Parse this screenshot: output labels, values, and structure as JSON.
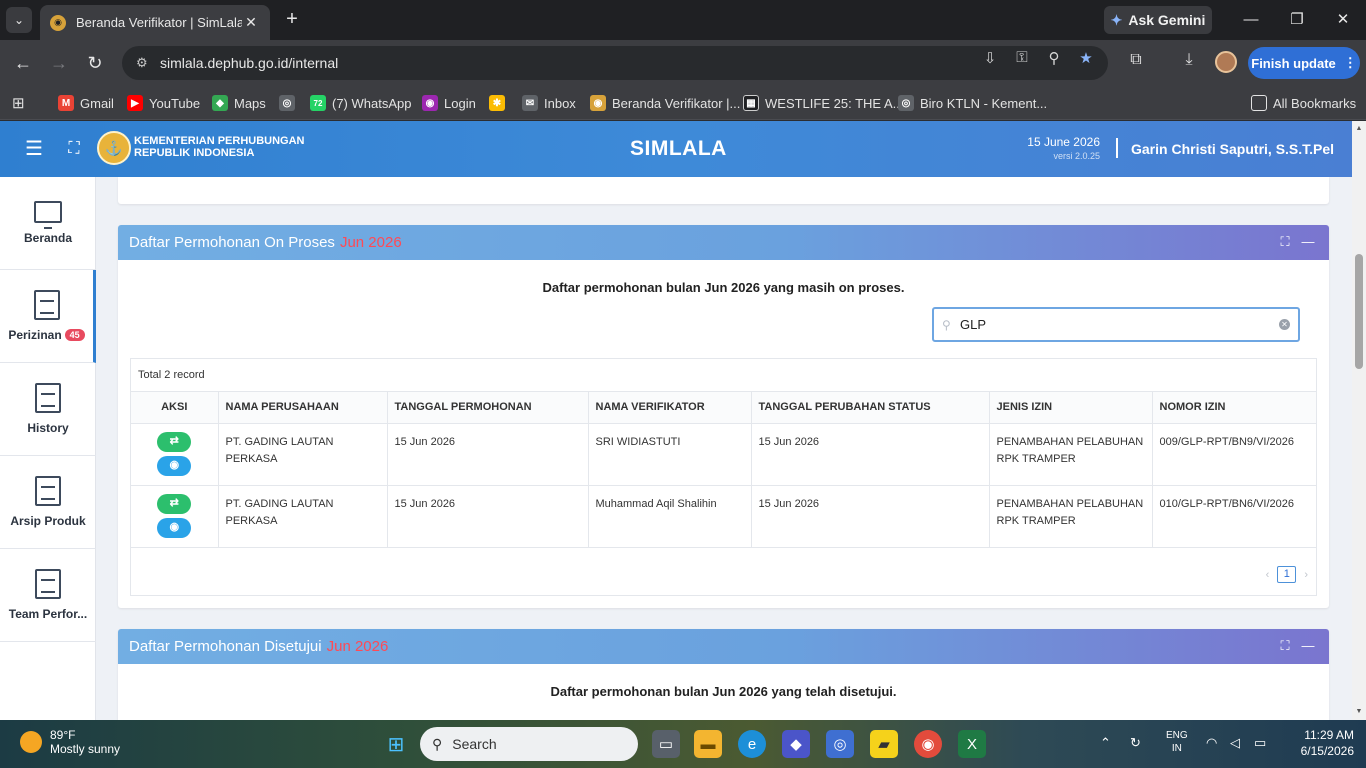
{
  "browser": {
    "tab_title": "Beranda Verifikator | SimLala",
    "tab_close": "✕",
    "new_tab": "+",
    "ask_gemini": "Ask Gemini",
    "url": "simlala.dephub.go.id/internal",
    "finish_update": "Finish update",
    "bookmarks": [
      {
        "label": "Gmail",
        "icon": "gmail-icon",
        "color": "#ea4335",
        "glyph": "M"
      },
      {
        "label": "YouTube",
        "icon": "youtube-icon",
        "color": "#ff0000",
        "glyph": "▶"
      },
      {
        "label": "Maps",
        "icon": "maps-icon",
        "color": "#34a853",
        "glyph": "◆"
      },
      {
        "label": "",
        "icon": "globe-icon",
        "color": "#5f6368",
        "glyph": "◎"
      },
      {
        "label": "(7) WhatsApp",
        "icon": "whatsapp-icon",
        "color": "#25d366",
        "glyph": "72"
      },
      {
        "label": "Login",
        "icon": "login-icon",
        "color": "#9c27b0",
        "glyph": "◉"
      },
      {
        "label": "",
        "icon": "pinwheel-icon",
        "color": "#fbbc04",
        "glyph": "✱"
      },
      {
        "label": "Inbox",
        "icon": "inbox-icon",
        "color": "#5f6368",
        "glyph": "✉"
      },
      {
        "label": "Beranda Verifikator |...",
        "icon": "simlala-icon",
        "color": "#d7a23a",
        "glyph": "◉"
      },
      {
        "label": "WESTLIFE 25: THE A...",
        "icon": "westlife-icon",
        "color": "#202124",
        "glyph": "▦"
      },
      {
        "label": "Biro KTLN - Kement...",
        "icon": "globe-icon",
        "color": "#5f6368",
        "glyph": "◎"
      }
    ],
    "all_bookmarks": "All Bookmarks"
  },
  "header": {
    "ministry_line1": "KEMENTERIAN PERHUBUNGAN",
    "ministry_line2": "REPUBLIK INDONESIA",
    "app_title": "SIMLALA",
    "date": "15 June 2026",
    "version": "versi 2.0.25",
    "user": "Garin Christi Saputri, S.S.T.Pel"
  },
  "sidebar": {
    "items": [
      {
        "label": "Beranda",
        "icon": "monitor-icon"
      },
      {
        "label": "Perizinan",
        "icon": "document-icon",
        "badge": "45"
      },
      {
        "label": "History",
        "icon": "document-icon"
      },
      {
        "label": "Arsip Produk",
        "icon": "document-icon"
      },
      {
        "label": "Team Perfor...",
        "icon": "document-icon"
      }
    ]
  },
  "panel_onproses": {
    "title": "Daftar Permohonan On Proses",
    "period": "Jun 2026",
    "subtitle": "Daftar permohonan bulan Jun 2026 yang masih on proses.",
    "search_value": "GLP",
    "total": "Total 2 record",
    "columns": [
      "AKSI",
      "NAMA PERUSAHAAN",
      "TANGGAL PERMOHONAN",
      "NAMA VERIFIKATOR",
      "TANGGAL PERUBAHAN STATUS",
      "JENIS IZIN",
      "NOMOR IZIN"
    ],
    "rows": [
      {
        "nama_perusahaan": "PT. GADING LAUTAN PERKASA",
        "tanggal_permohonan": "15 Jun 2026",
        "nama_verifikator": "SRI WIDIASTUTI",
        "tanggal_perubahan_status": "15 Jun 2026",
        "jenis_izin": "PENAMBAHAN PELABUHAN RPK TRAMPER",
        "nomor_izin": "009/GLP-RPT/BN9/VI/2026"
      },
      {
        "nama_perusahaan": "PT. GADING LAUTAN PERKASA",
        "tanggal_permohonan": "15 Jun 2026",
        "nama_verifikator": "Muhammad Aqil Shalihin",
        "tanggal_perubahan_status": "15 Jun 2026",
        "jenis_izin": "PENAMBAHAN PELABUHAN RPK TRAMPER",
        "nomor_izin": "010/GLP-RPT/BN6/VI/2026"
      }
    ],
    "page": "1"
  },
  "panel_disetujui": {
    "title": "Daftar Permohonan Disetujui",
    "period": "Jun 2026",
    "subtitle": "Daftar permohonan bulan Jun 2026 yang telah disetujui."
  },
  "taskbar": {
    "temp": "89°F",
    "weather": "Mostly sunny",
    "search": "Search",
    "lang1": "ENG",
    "lang2": "IN",
    "time": "11:29 AM",
    "date": "6/15/2026"
  }
}
